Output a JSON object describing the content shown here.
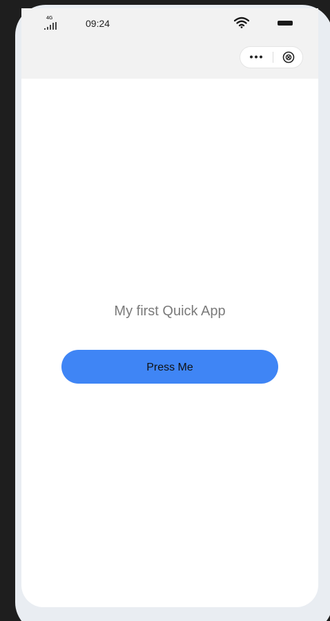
{
  "status_bar": {
    "network": "4G",
    "time": "09:24",
    "icons": [
      "signal-icon",
      "wifi-icon",
      "battery-icon"
    ]
  },
  "capsule": {
    "icons": [
      "more-icon",
      "close-circle-icon"
    ]
  },
  "content": {
    "title": "My first Quick App",
    "button_label": "Press Me"
  },
  "colors": {
    "button": "#3f85f5",
    "top_area": "#f2f2f2",
    "frame": "#e9edf2",
    "background": "#1e1e1e",
    "title_text": "#7a7a7a"
  }
}
